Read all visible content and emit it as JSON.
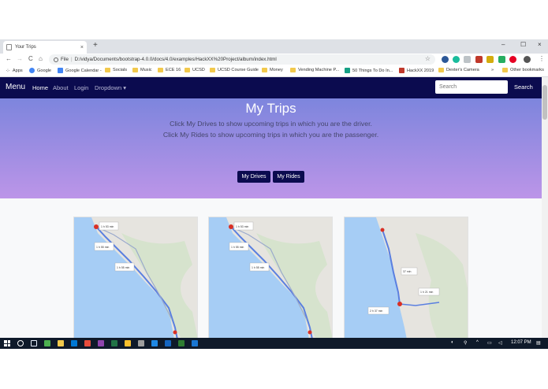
{
  "browser": {
    "tab_title": "Your Trips",
    "tab_close": "×",
    "new_tab": "+",
    "window_controls": {
      "minimize": "–",
      "maximize": "☐",
      "close": "×"
    },
    "nav": {
      "back": "←",
      "forward": "→",
      "reload": "C",
      "home": "⌂"
    },
    "url_prefix": "File",
    "url": "D:/vidya/Documents/bootstrap-4.0.0/docs/4.0/examples/HackXX%20Project/album/index.html",
    "star": "☆",
    "bookmarks": [
      "Apps",
      "Google",
      "Google Calendar -",
      "Socials",
      "Music",
      "ECE 16",
      "UCSD",
      "UCSD Course Guide",
      "Money",
      "Vending Machine P...",
      "50 Things To Do In...",
      "HackXX 2019",
      "Dexter's Camera",
      "»",
      "Other bookmarks"
    ]
  },
  "site": {
    "brand": "Menu",
    "nav_links": [
      "Home",
      "About",
      "Login",
      "Dropdown ▾"
    ],
    "search_placeholder": "Search",
    "search_button": "Search",
    "hero": {
      "title": "My Trips",
      "line1": "Click My Drives to show upcoming trips in which you are the driver.",
      "line2": "Click My Rides to show upcoming trips in which you are the passenger.",
      "drives_button": "My Drives",
      "rides_button": "My Rides"
    },
    "cards": [
      {
        "labels": [
          "1 h 53 min",
          "1 h 55 min",
          "1 h 55 min"
        ]
      },
      {
        "labels": [
          "1 h 53 min",
          "1 h 55 min",
          "1 h 55 min"
        ]
      },
      {
        "labels": [
          "37 min",
          "1 h 21 min",
          "2 h 37 min"
        ]
      }
    ]
  },
  "taskbar": {
    "time": "12:07 PM",
    "icon_colors": [
      "#ffffff",
      "#e8f0fe",
      "#4caf50",
      "#f2c94c",
      "#0078d4",
      "#e74c3c",
      "#8e44ad",
      "#217346",
      "#fbc02d",
      "#9e9e9e",
      "#1e88e5",
      "#1565c0",
      "#2e7d32",
      "#1976d2"
    ]
  }
}
